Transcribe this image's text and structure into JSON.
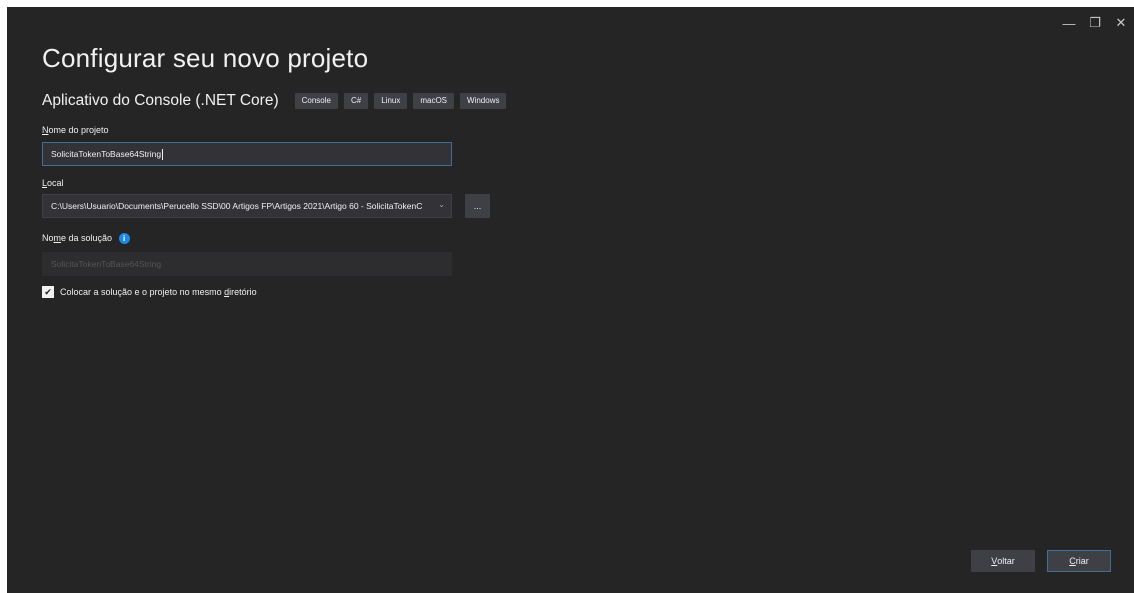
{
  "window": {
    "controls": {
      "minimize": "—",
      "restore": "❐",
      "close": "✕"
    }
  },
  "page": {
    "title": "Configurar seu novo projeto"
  },
  "template": {
    "name": "Aplicativo do Console (.NET Core)",
    "tags": [
      "Console",
      "C#",
      "Linux",
      "macOS",
      "Windows"
    ]
  },
  "project_name": {
    "label_accel": "N",
    "label_rest": "ome do projeto",
    "value": "SolicitaTokenToBase64String"
  },
  "location": {
    "label_accel": "L",
    "label_rest": "ocal",
    "value": "C:\\Users\\Usuario\\Documents\\Perucello SSD\\00 Artigos FP\\Artigos 2021\\Artigo 60 - SolicitaTokenC",
    "browse_label": "..."
  },
  "solution_name": {
    "label_pre": "No",
    "label_accel": "m",
    "label_post": "e da solução",
    "value": "SolicitaTokenToBase64String"
  },
  "same_directory": {
    "checked": true,
    "label_pre": "Colocar a solução e o projeto no mesmo ",
    "label_accel": "d",
    "label_post": "iretório"
  },
  "footer": {
    "back_accel": "V",
    "back_rest": "oltar",
    "create_accel": "C",
    "create_rest": "riar"
  },
  "colors": {
    "background": "#252526",
    "input_background": "#333337",
    "focus_border": "#3e6f99",
    "info_icon": "#1e8ae6",
    "tag_background": "#3f3f46"
  }
}
